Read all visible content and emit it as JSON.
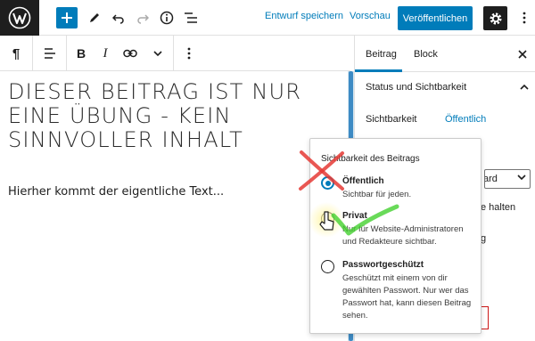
{
  "toolbar": {
    "save_draft_label": "Entwurf speichern",
    "preview_label": "Vorschau",
    "publish_label": "Veröffentlichen"
  },
  "block_toolbar": {
    "paragraph_glyph": "¶",
    "bold_glyph": "B",
    "italic_glyph": "I"
  },
  "editor": {
    "title": "DIESER BEITRAG IST NUR EINE ÜBUNG - KEIN SINNVOLLER INHALT",
    "paragraph": "Hierher kommt der eigentliche Text..."
  },
  "sidebar": {
    "tabs": [
      {
        "label": "Beitrag",
        "active": true
      },
      {
        "label": "Block",
        "active": false
      }
    ],
    "section_title": "Status und Sichtbarkeit",
    "visibility_label": "Sichtbarkeit",
    "visibility_value": "Öffentlich",
    "select_fragment": "ard",
    "sticky_fragment": "e halten",
    "other_fragment": "g",
    "danger_fragment": "n"
  },
  "popover": {
    "title": "Sichtbarkeit des Beitrags",
    "options": [
      {
        "label": "Öffentlich",
        "description": "Sichtbar für jeden.",
        "checked": true
      },
      {
        "label": "Privat",
        "description": "Nur für Website-Administratoren und Redakteure sichtbar.",
        "checked": false
      },
      {
        "label": "Passwortgeschützt",
        "description": "Geschützt mit einem von dir gewählten Passwort. Nur wer das Passwort hat, kann diesen Beitrag sehen.",
        "checked": false
      }
    ]
  },
  "colors": {
    "accent": "#007cba",
    "dark": "#1e1e1e",
    "annotation_cross": "#e53935",
    "annotation_check": "#43d12f",
    "danger": "#cc1818"
  },
  "icons": [
    "wordpress-logo",
    "plus-icon",
    "pen-icon",
    "undo-icon",
    "redo-icon",
    "info-icon",
    "list-view-icon",
    "gear-icon",
    "more-vertical-icon",
    "paragraph-icon",
    "align-icon",
    "link-icon",
    "chevron-down-icon",
    "close-icon",
    "chevron-up-icon",
    "pointer-hand-icon"
  ]
}
